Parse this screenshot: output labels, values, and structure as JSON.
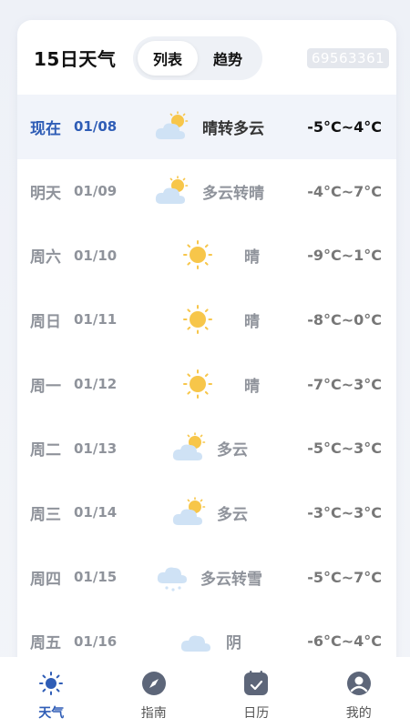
{
  "header": {
    "title": "15日天气",
    "tabs": [
      {
        "label": "列表",
        "active": true
      },
      {
        "label": "趋势",
        "active": false
      }
    ],
    "badge": "69563361"
  },
  "forecast": [
    {
      "day": "现在",
      "date": "01/08",
      "icon": "partly-cloudy-icon",
      "condition": "晴转多云",
      "temp": "-5°C~4°C",
      "current": true
    },
    {
      "day": "明天",
      "date": "01/09",
      "icon": "partly-cloudy-icon",
      "condition": "多云转晴",
      "temp": "-4°C~7°C"
    },
    {
      "day": "周六",
      "date": "01/10",
      "icon": "sunny-icon",
      "condition": "晴",
      "temp": "-9°C~1°C"
    },
    {
      "day": "周日",
      "date": "01/11",
      "icon": "sunny-icon",
      "condition": "晴",
      "temp": "-8°C~0°C"
    },
    {
      "day": "周一",
      "date": "01/12",
      "icon": "sunny-icon",
      "condition": "晴",
      "temp": "-7°C~3°C"
    },
    {
      "day": "周二",
      "date": "01/13",
      "icon": "partly-cloudy-icon",
      "condition": "多云",
      "temp": "-5°C~3°C"
    },
    {
      "day": "周三",
      "date": "01/14",
      "icon": "partly-cloudy-icon",
      "condition": "多云",
      "temp": "-3°C~3°C"
    },
    {
      "day": "周四",
      "date": "01/15",
      "icon": "cloudy-snow-icon",
      "condition": "多云转雪",
      "temp": "-5°C~7°C"
    },
    {
      "day": "周五",
      "date": "01/16",
      "icon": "overcast-icon",
      "condition": "阴",
      "temp": "-6°C~4°C"
    }
  ],
  "tabbar": [
    {
      "label": "天气",
      "icon": "sun-icon",
      "active": true
    },
    {
      "label": "指南",
      "icon": "compass-icon"
    },
    {
      "label": "日历",
      "icon": "calendar-icon"
    },
    {
      "label": "我的",
      "icon": "user-icon"
    }
  ],
  "colors": {
    "accent": "#2f5db6",
    "sun": "#f7c64a",
    "cloud": "#cfe2f5"
  }
}
